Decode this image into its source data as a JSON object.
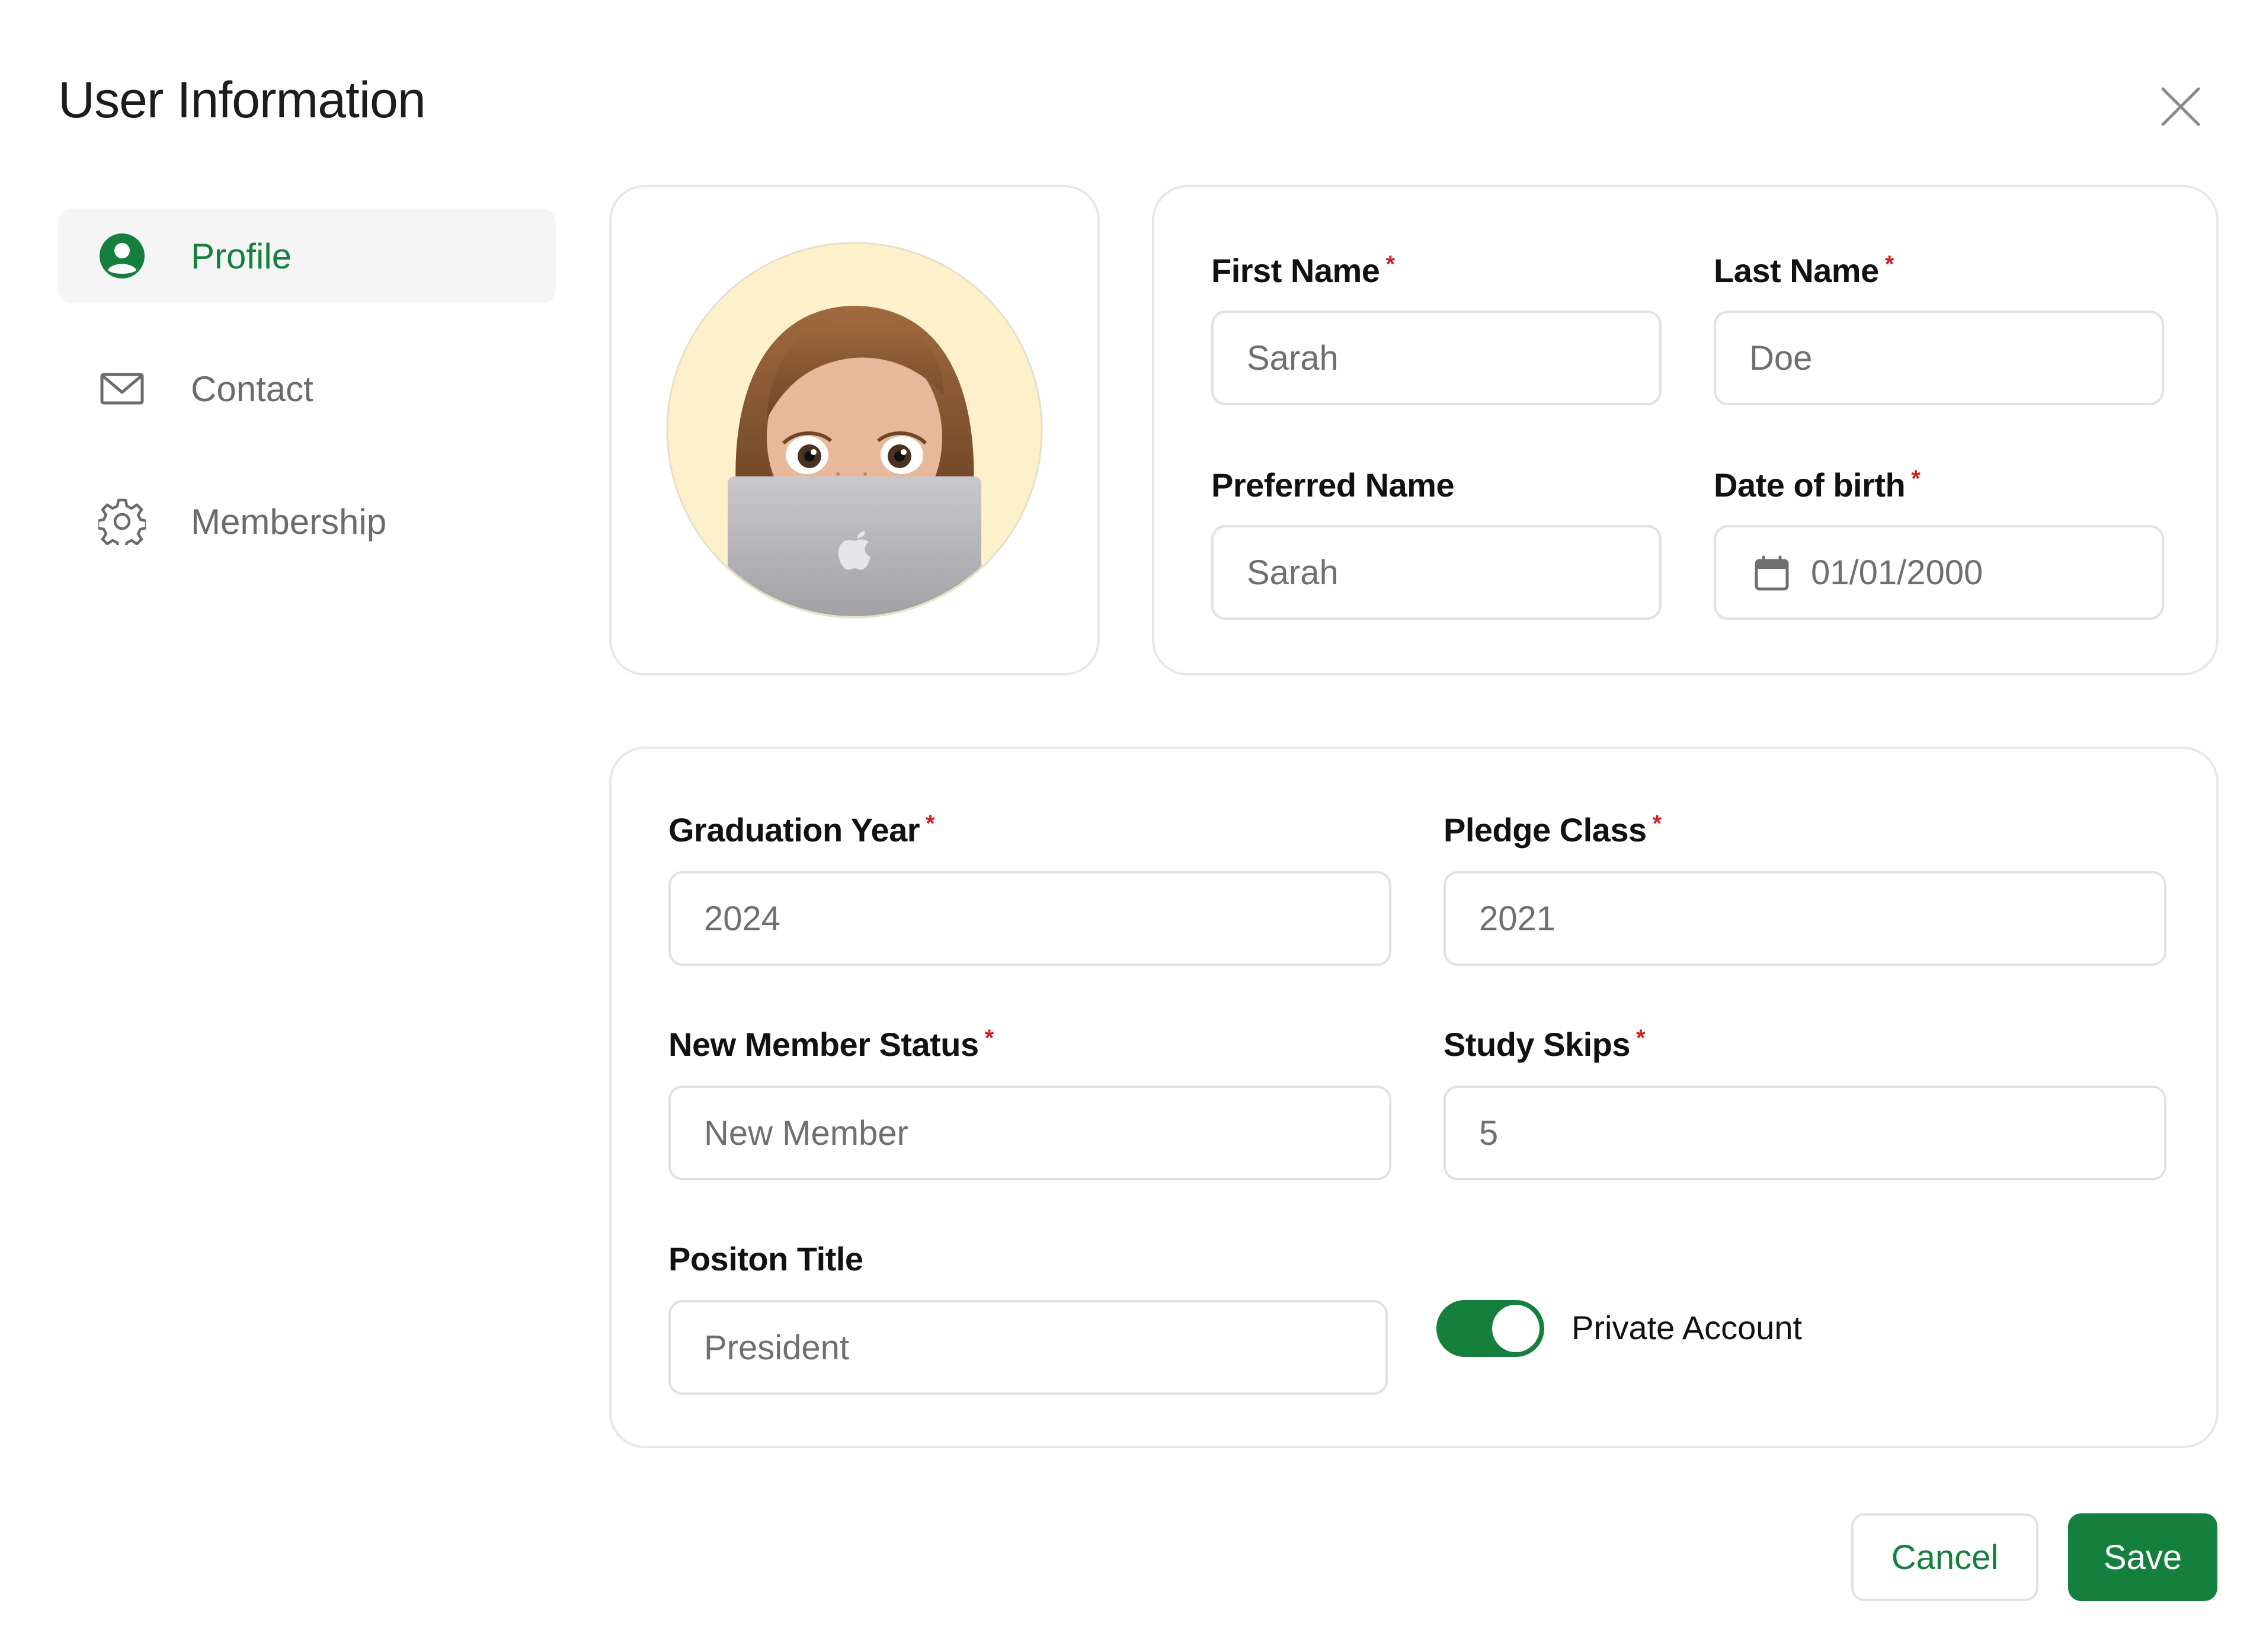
{
  "window": {
    "title": "User Information",
    "close_icon": "close-icon"
  },
  "sidebar": {
    "items": [
      {
        "label": "Profile",
        "icon": "user-circle-icon",
        "active": true
      },
      {
        "label": "Contact",
        "icon": "mail-icon",
        "active": false
      },
      {
        "label": "Membership",
        "icon": "gear-icon",
        "active": false
      }
    ]
  },
  "profile": {
    "avatar": "memoji-avatar",
    "first_name": {
      "label": "First Name",
      "required": "*",
      "value": "Sarah"
    },
    "last_name": {
      "label": "Last Name",
      "required": "*",
      "value": "Doe"
    },
    "preferred_name": {
      "label": "Preferred Name",
      "value": "Sarah"
    },
    "dob": {
      "label": "Date of birth",
      "required": "*",
      "value": "01/01/2000",
      "icon": "calendar-icon"
    }
  },
  "membership": {
    "graduation_year": {
      "label": "Graduation Year",
      "required": "*",
      "value": "2024"
    },
    "pledge_class": {
      "label": "Pledge Class",
      "required": "*",
      "value": "2021"
    },
    "new_member_status": {
      "label": "New Member Status",
      "required": "*",
      "value": "New Member"
    },
    "study_skips": {
      "label": "Study Skips",
      "required": "*",
      "value": "5"
    },
    "position_title": {
      "label": "Positon Title",
      "value": "President"
    },
    "private_account": {
      "label": "Private Account",
      "enabled": true
    }
  },
  "actions": {
    "cancel_label": "Cancel",
    "save_label": "Save"
  },
  "colors": {
    "accent": "#15803d",
    "required": "#d11f1f",
    "border": "#e2e2e2",
    "active_nav_bg": "#f5f5f5"
  }
}
